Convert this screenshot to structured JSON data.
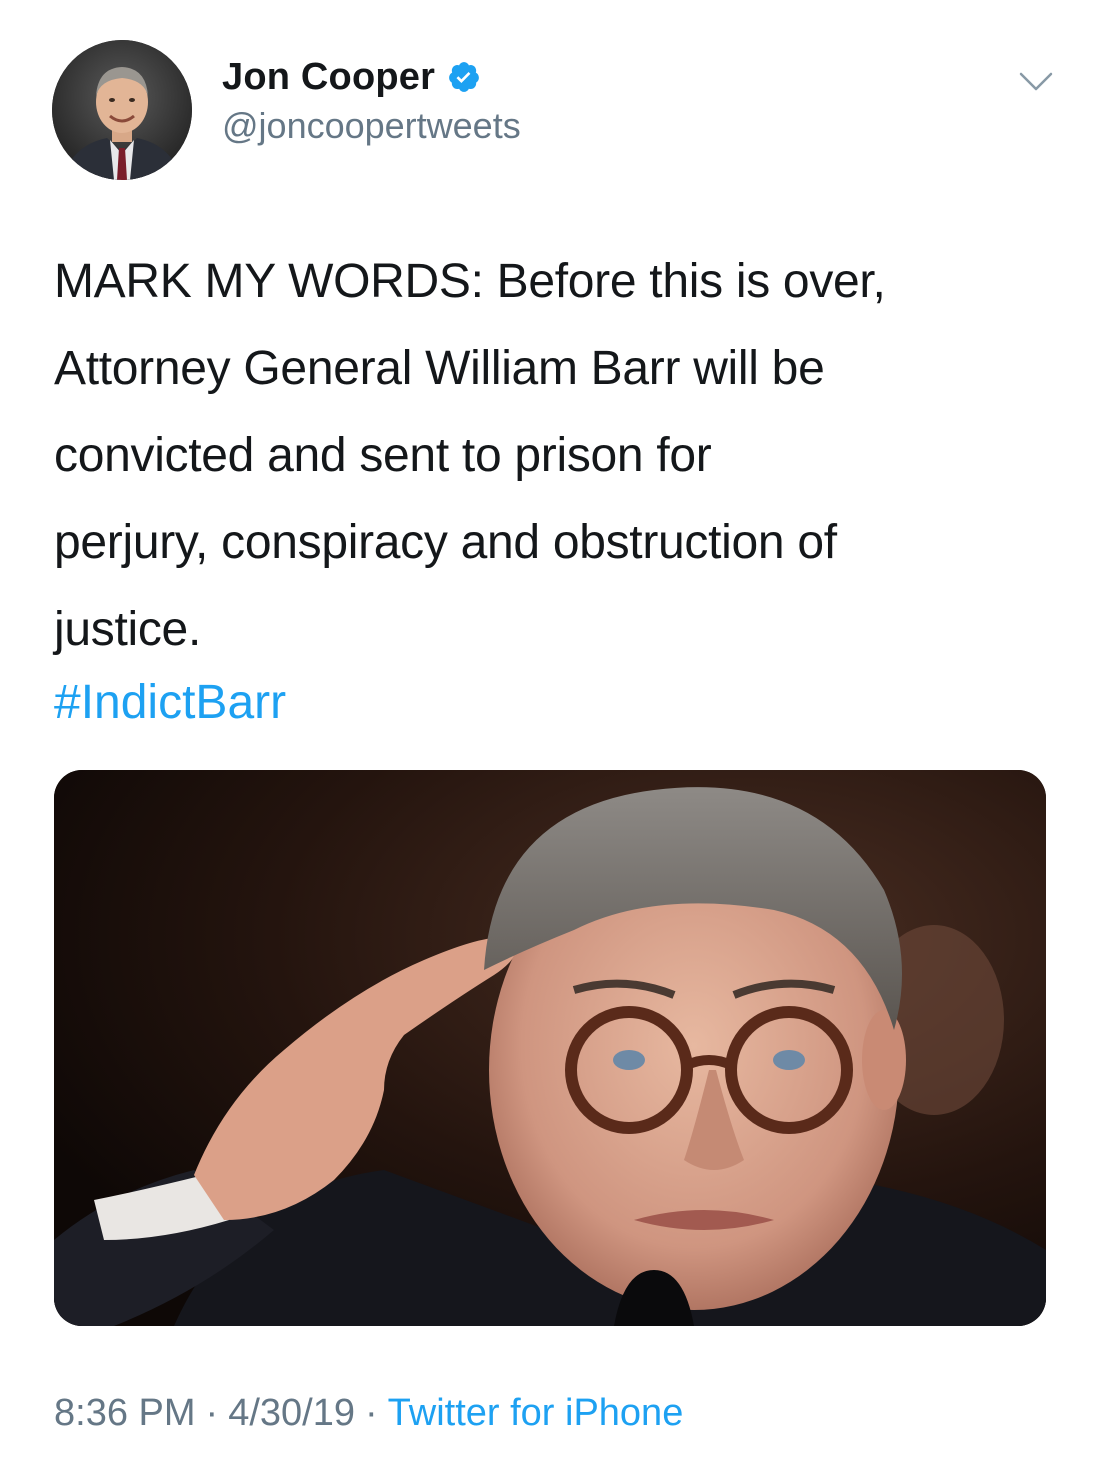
{
  "author": {
    "display_name": "Jon Cooper",
    "handle": "@joncoopertweets",
    "verified": true,
    "avatar_icon": "profile-photo"
  },
  "tweet": {
    "text_lines": [
      "MARK MY WORDS: Before this is over,",
      "Attorney General William Barr will be",
      "convicted and sent to prison for",
      "perjury, conspiracy and obstruction of",
      "justice."
    ],
    "hashtag": "#IndictBarr",
    "media_icon": "photo"
  },
  "footer": {
    "time": "8:36 PM",
    "date": "4/30/19",
    "separator": "·",
    "source": "Twitter for iPhone"
  },
  "colors": {
    "link": "#1da1f2",
    "secondary_text": "#657786",
    "primary_text": "#14171a",
    "verified_badge": "#1da1f2"
  }
}
